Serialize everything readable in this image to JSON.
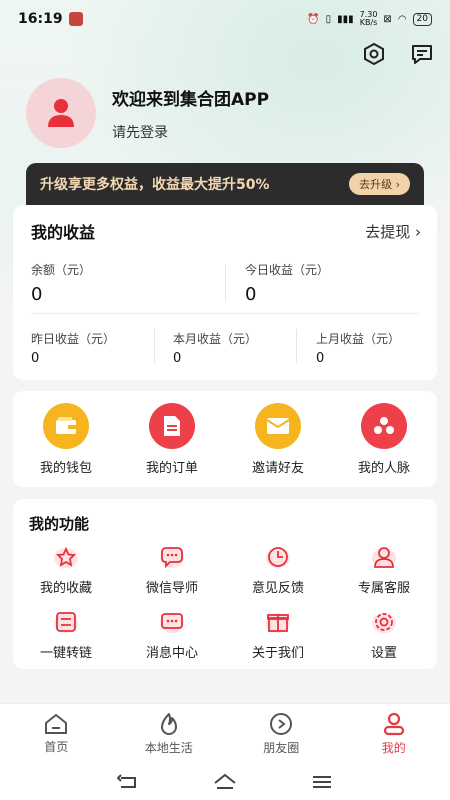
{
  "status": {
    "time": "16:19",
    "speed_top": "7.30",
    "speed_unit": "KB/s",
    "battery": "20"
  },
  "profile": {
    "welcome": "欢迎来到集合团APP",
    "login": "请先登录"
  },
  "upgrade": {
    "text": "升级享更多权益，收益最大提升50%",
    "button": "去升级 ›"
  },
  "earnings": {
    "title": "我的收益",
    "withdraw": "去提现 ›",
    "balance_label": "余额（元）",
    "balance": "0",
    "today_label": "今日收益（元）",
    "today": "0",
    "yesterday_label": "昨日收益（元）",
    "yesterday": "0",
    "month_label": "本月收益（元）",
    "month": "0",
    "last_month_label": "上月收益（元）",
    "last_month": "0"
  },
  "quick": [
    {
      "label": "我的钱包",
      "icon": "wallet-icon",
      "color": "#f6b51e"
    },
    {
      "label": "我的订单",
      "icon": "order-icon",
      "color": "#ee4048"
    },
    {
      "label": "邀请好友",
      "icon": "envelope-icon",
      "color": "#f6b51e"
    },
    {
      "label": "我的人脉",
      "icon": "network-icon",
      "color": "#ee4048"
    }
  ],
  "features": {
    "title": "我的功能",
    "items": [
      {
        "label": "我的收藏",
        "icon": "star-icon"
      },
      {
        "label": "微信导师",
        "icon": "chat-icon"
      },
      {
        "label": "意见反馈",
        "icon": "feedback-icon"
      },
      {
        "label": "专属客服",
        "icon": "service-icon"
      },
      {
        "label": "一键转链",
        "icon": "link-icon"
      },
      {
        "label": "消息中心",
        "icon": "message-icon"
      },
      {
        "label": "关于我们",
        "icon": "gift-icon"
      },
      {
        "label": "设置",
        "icon": "settings-icon"
      }
    ]
  },
  "tabs": [
    {
      "label": "首页",
      "icon": "home-icon"
    },
    {
      "label": "本地生活",
      "icon": "flame-icon"
    },
    {
      "label": "朋友圈",
      "icon": "circle-icon"
    },
    {
      "label": "我的",
      "icon": "user-icon"
    }
  ],
  "colors": {
    "accent": "#e23b45",
    "dark_bar": "#2c2c2c",
    "gold": "#f4d8b5"
  }
}
